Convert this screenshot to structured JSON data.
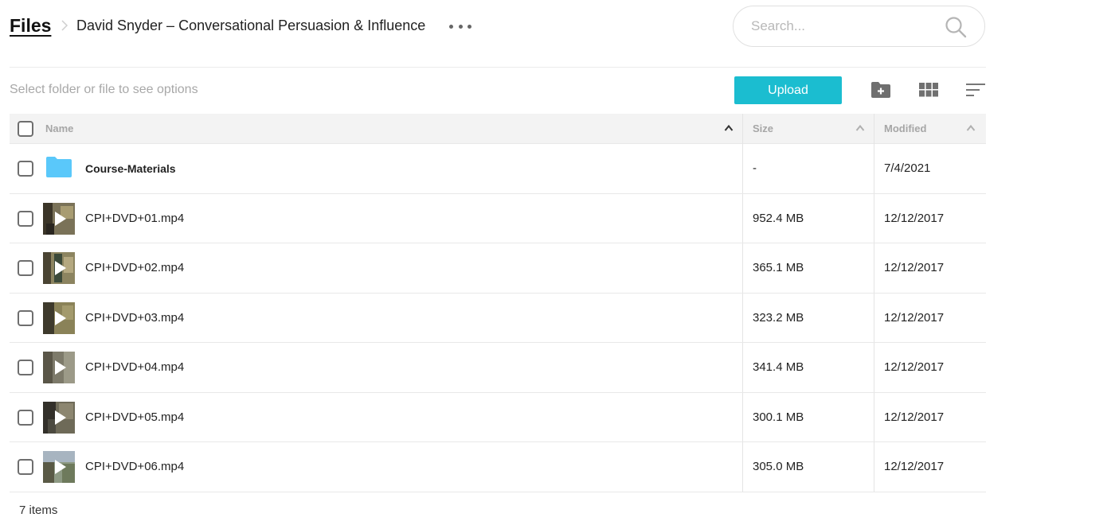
{
  "breadcrumb": {
    "root": "Files",
    "current": "David Snyder – Conversational Persuasion & Influence"
  },
  "search": {
    "placeholder": "Search..."
  },
  "toolbar": {
    "hint": "Select folder or file to see options",
    "upload_label": "Upload",
    "upload_color": "#1bbdd0"
  },
  "table": {
    "columns": {
      "name": "Name",
      "size": "Size",
      "modified": "Modified"
    },
    "rows": [
      {
        "type": "folder",
        "name": "Course-Materials",
        "size": "-",
        "modified": "7/4/2021",
        "icon": "folder-icon"
      },
      {
        "type": "video",
        "name": "CPI+DVD+01.mp4",
        "size": "952.4 MB",
        "modified": "12/12/2017",
        "icon": "video-thumbnail"
      },
      {
        "type": "video",
        "name": "CPI+DVD+02.mp4",
        "size": "365.1 MB",
        "modified": "12/12/2017",
        "icon": "video-thumbnail"
      },
      {
        "type": "video",
        "name": "CPI+DVD+03.mp4",
        "size": "323.2 MB",
        "modified": "12/12/2017",
        "icon": "video-thumbnail"
      },
      {
        "type": "video",
        "name": "CPI+DVD+04.mp4",
        "size": "341.4 MB",
        "modified": "12/12/2017",
        "icon": "video-thumbnail"
      },
      {
        "type": "video",
        "name": "CPI+DVD+05.mp4",
        "size": "300.1 MB",
        "modified": "12/12/2017",
        "icon": "video-thumbnail"
      },
      {
        "type": "video",
        "name": "CPI+DVD+06.mp4",
        "size": "305.0 MB",
        "modified": "12/12/2017",
        "icon": "video-thumbnail"
      }
    ]
  },
  "footer": {
    "count": "7 items"
  },
  "colors": {
    "folder": "#5ac8fa",
    "accent": "#1bbdd0"
  }
}
